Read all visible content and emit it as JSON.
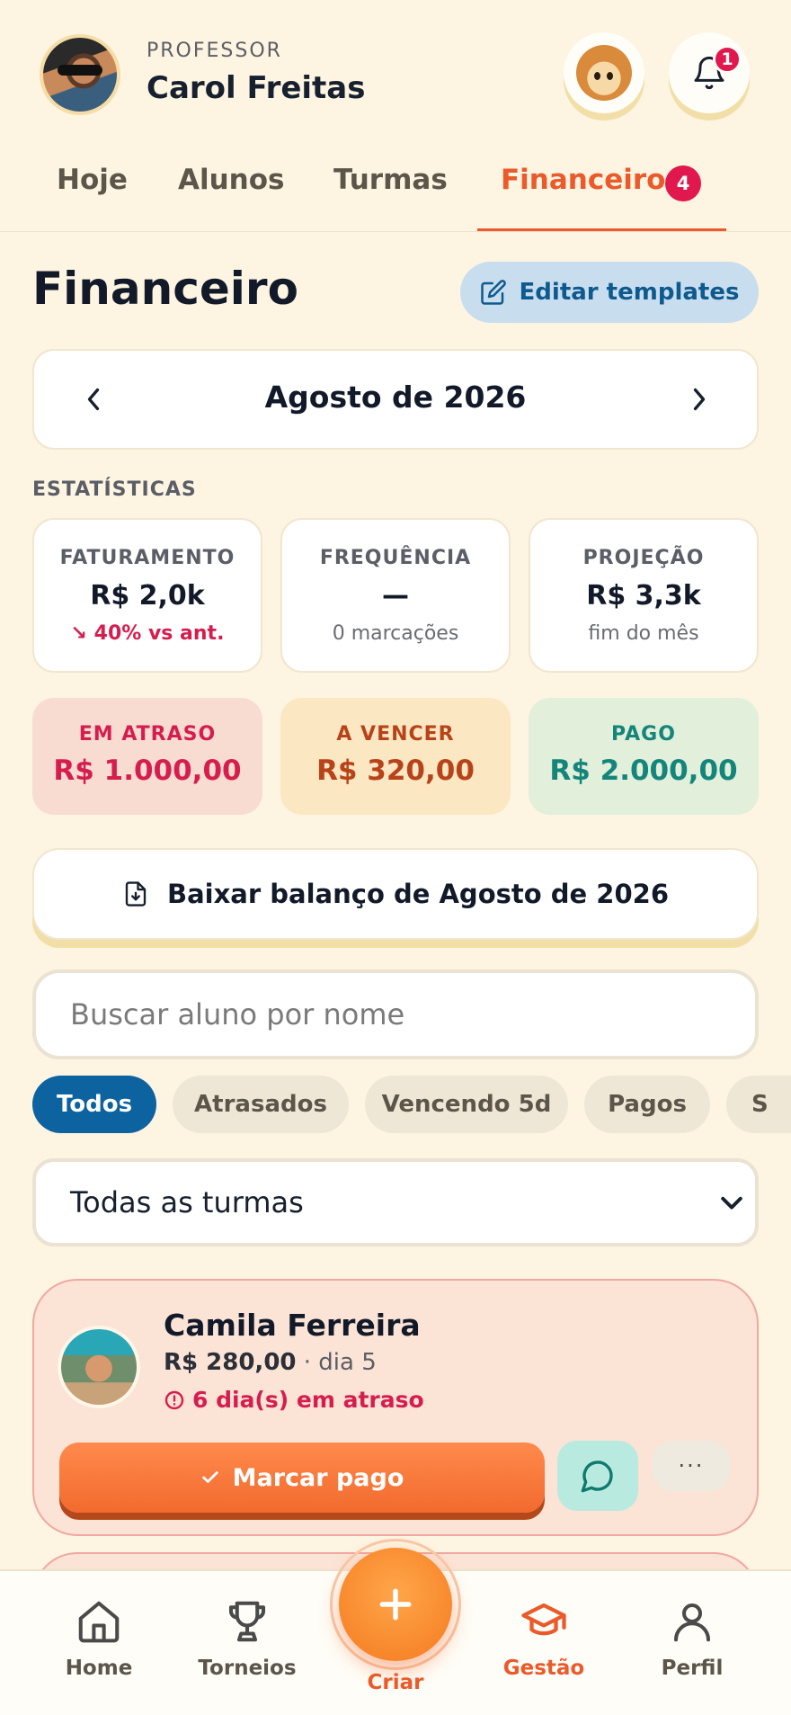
{
  "header": {
    "role_label": "PROFESSOR",
    "user_name": "Carol Freitas",
    "notification_count": "1"
  },
  "tabs": [
    {
      "label": "Hoje"
    },
    {
      "label": "Alunos"
    },
    {
      "label": "Turmas"
    },
    {
      "label": "Financeiro",
      "badge": "4",
      "active": true
    }
  ],
  "page": {
    "title": "Financeiro",
    "edit_templates_label": "Editar templates"
  },
  "month_selector": {
    "label": "Agosto de 2026"
  },
  "stats": {
    "section_label": "ESTATÍSTICAS",
    "cards": [
      {
        "title": "FATURAMENTO",
        "value": "R$ 2,0k",
        "sub": "↘ 40% vs ant."
      },
      {
        "title": "FREQUÊNCIA",
        "value": "—",
        "sub": "0 marcações"
      },
      {
        "title": "PROJEÇÃO",
        "value": "R$ 3,3k",
        "sub": "fim do mês"
      }
    ]
  },
  "status_totals": [
    {
      "title": "EM ATRASO",
      "value": "R$ 1.000,00",
      "color": "#D61E4E",
      "bg": "#F8DCD2"
    },
    {
      "title": "A VENCER",
      "value": "R$ 320,00",
      "color": "#B8431A",
      "bg": "#FCE7C3"
    },
    {
      "title": "PAGO",
      "value": "R$ 2.000,00",
      "color": "#14857A",
      "bg": "#E1EFDB"
    }
  ],
  "download": {
    "label": "Baixar balanço de Agosto de 2026"
  },
  "search": {
    "placeholder": "Buscar aluno por nome"
  },
  "filters": [
    {
      "label": "Todos",
      "active": true
    },
    {
      "label": "Atrasados"
    },
    {
      "label": "Vencendo 5d"
    },
    {
      "label": "Pagos"
    },
    {
      "label": "S"
    }
  ],
  "class_select": {
    "selected": "Todas as turmas"
  },
  "students": [
    {
      "name": "Camila Ferreira",
      "amount": "R$ 280,00",
      "due": " · dia 5",
      "status": "6 dia(s) em atraso",
      "pay_label": "Marcar pago",
      "more_label": "···"
    }
  ],
  "bottom_nav": {
    "items": [
      {
        "label": "Home",
        "icon": "home-icon"
      },
      {
        "label": "Torneios",
        "icon": "trophy-icon"
      },
      {
        "label": "Criar",
        "icon": "plus-icon"
      },
      {
        "label": "Gestão",
        "icon": "graduation-cap-icon",
        "active": true
      },
      {
        "label": "Perfil",
        "icon": "user-icon"
      }
    ]
  },
  "colors": {
    "background": "#FDF4E1",
    "accent": "#EA5A2A",
    "primary_blue": "#0D62A0",
    "danger": "#D61E4E"
  }
}
